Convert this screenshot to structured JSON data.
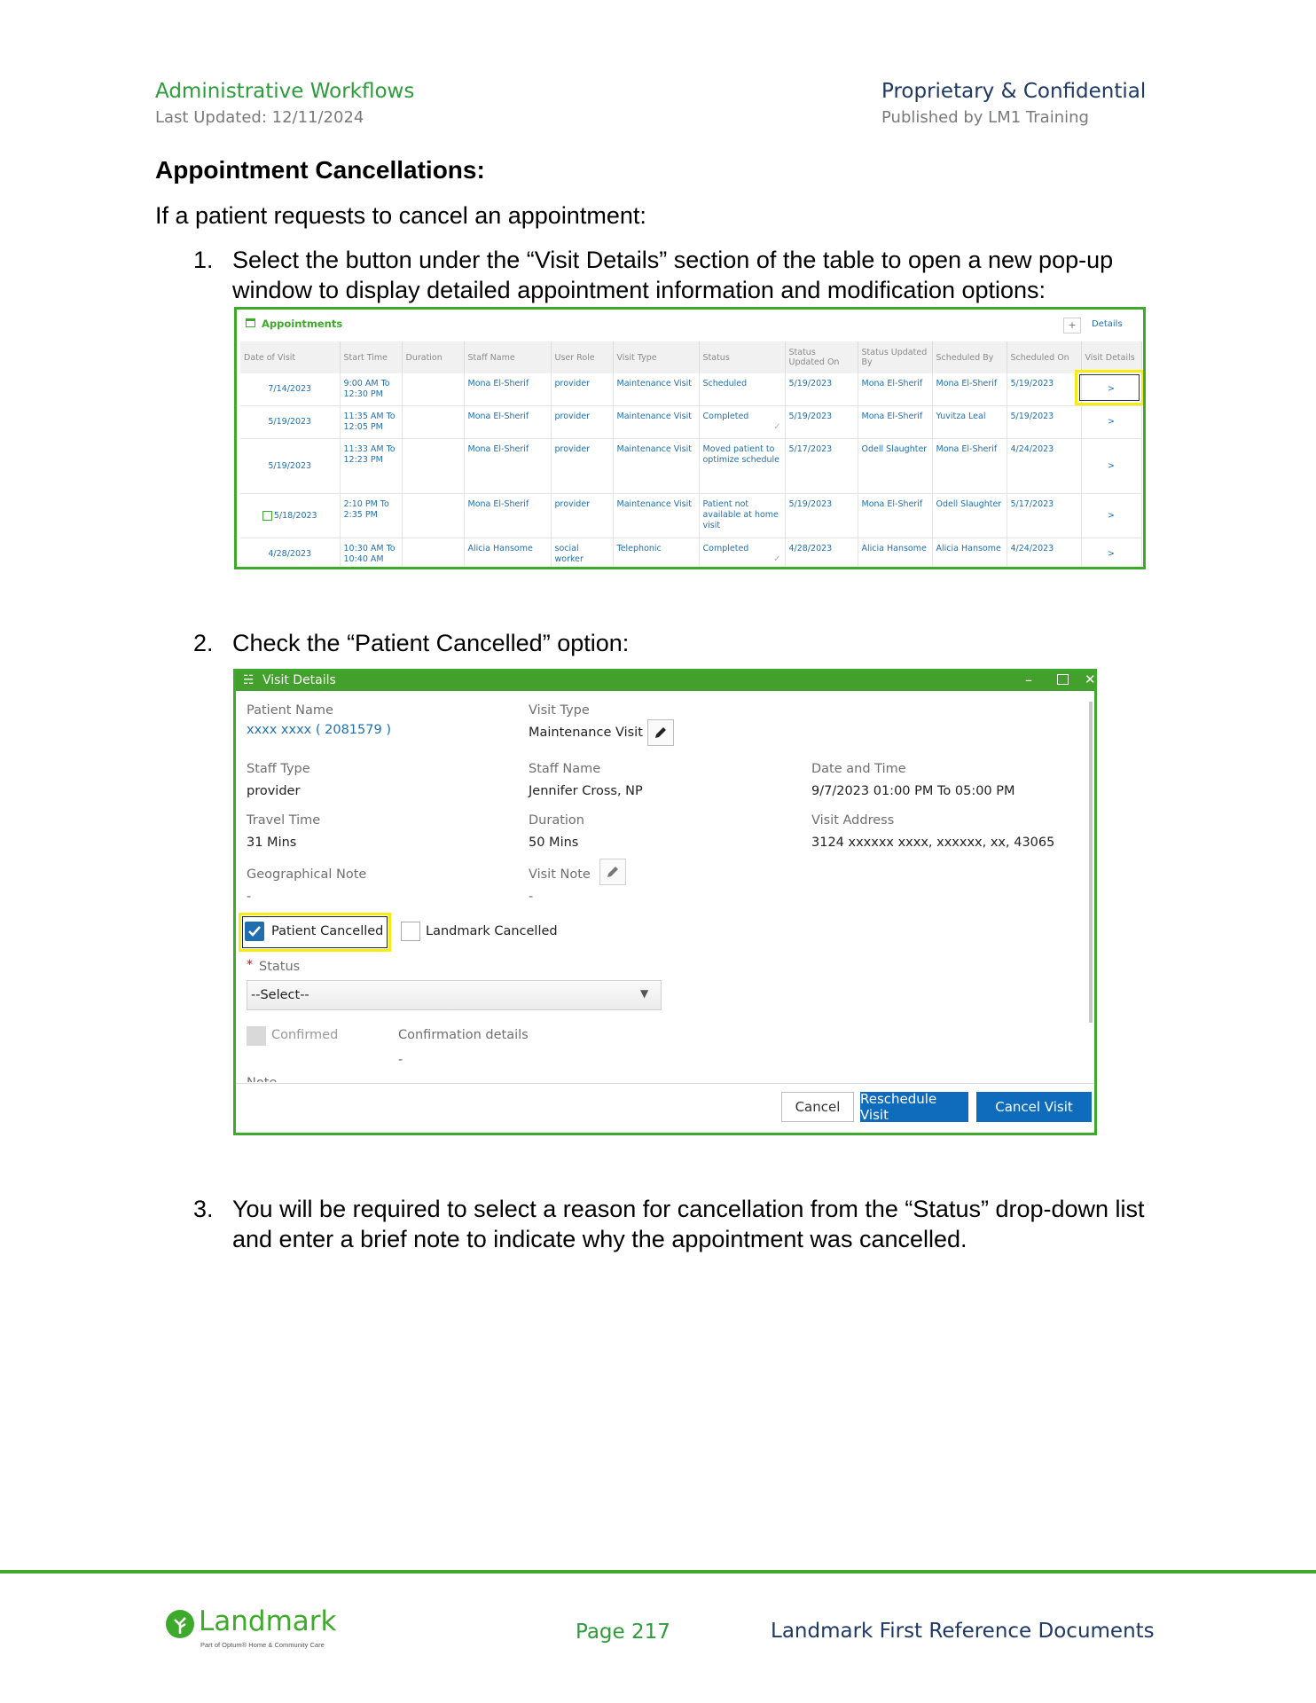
{
  "header": {
    "left_title": "Administrative Workflows",
    "left_sub": "Last Updated: 12/11/2024",
    "right_title": "Proprietary & Confidential",
    "right_sub": "Published by LM1 Training"
  },
  "section_title": "Appointment Cancellations:",
  "intro": "If a patient requests to cancel an appointment:",
  "steps": [
    {
      "num": "1.",
      "text": "Select the button under the “Visit Details” section of the table to open a new pop-up window to display detailed appointment information and modification options:"
    },
    {
      "num": "2.",
      "text": "Check the “Patient Cancelled” option:"
    },
    {
      "num": "3.",
      "text": "You will be required to select a reason for cancellation from the “Status” drop-down list and enter a brief note to indicate why the appointment was cancelled."
    }
  ],
  "appointments": {
    "title": "Appointments",
    "add_label": "+",
    "details_label": "Details",
    "columns": [
      "Date of Visit",
      "Start Time",
      "Duration",
      "Staff Name",
      "User Role",
      "Visit Type",
      "Status",
      "Status Updated On",
      "Status Updated By",
      "Scheduled By",
      "Scheduled On",
      "Visit Details"
    ],
    "rows": [
      {
        "date": "7/14/2023",
        "start": "9:00 AM To 12:30 PM",
        "duration": "",
        "staff": "Mona El-Sherif",
        "role": "provider",
        "visit_type": "Maintenance Visit",
        "status": "Scheduled",
        "checked": false,
        "updated_on": "5/19/2023",
        "updated_by": "Mona El-Sherif",
        "scheduled_by": "Mona El-Sherif",
        "scheduled_on": "5/19/2023",
        "details": ">",
        "calendar_icon": false
      },
      {
        "date": "5/19/2023",
        "start": "11:35 AM To 12:05 PM",
        "duration": "",
        "staff": "Mona El-Sherif",
        "role": "provider",
        "visit_type": "Maintenance Visit",
        "status": "Completed",
        "checked": true,
        "updated_on": "5/19/2023",
        "updated_by": "Mona El-Sherif",
        "scheduled_by": "Yuvitza Leal",
        "scheduled_on": "5/19/2023",
        "details": ">",
        "calendar_icon": false
      },
      {
        "date": "5/19/2023",
        "start": "11:33 AM To 12:23 PM",
        "duration": "",
        "staff": "Mona El-Sherif",
        "role": "provider",
        "visit_type": "Maintenance Visit",
        "status": "Moved patient to optimize schedule",
        "checked": false,
        "updated_on": "5/17/2023",
        "updated_by": "Odell Slaughter",
        "scheduled_by": "Mona El-Sherif",
        "scheduled_on": "4/24/2023",
        "details": ">",
        "calendar_icon": false
      },
      {
        "date": "5/18/2023",
        "start": "2:10 PM To 2:35 PM",
        "duration": "",
        "staff": "Mona El-Sherif",
        "role": "provider",
        "visit_type": "Maintenance Visit",
        "status": "Patient not available at home visit",
        "checked": false,
        "updated_on": "5/19/2023",
        "updated_by": "Mona El-Sherif",
        "scheduled_by": "Odell Slaughter",
        "scheduled_on": "5/17/2023",
        "details": ">",
        "calendar_icon": true
      },
      {
        "date": "4/28/2023",
        "start": "10:30 AM To 10:40 AM",
        "duration": "",
        "staff": "Alicia Hansome",
        "role": "social worker",
        "visit_type": "Telephonic",
        "status": "Completed",
        "checked": true,
        "updated_on": "4/28/2023",
        "updated_by": "Alicia Hansome",
        "scheduled_by": "Alicia Hansome",
        "scheduled_on": "4/24/2023",
        "details": ">",
        "calendar_icon": false
      }
    ]
  },
  "visit_details": {
    "title": "Visit Details",
    "patient_name_label": "Patient Name",
    "patient_name": "xxxx xxxx ( 2081579 )",
    "visit_type_label": "Visit Type",
    "visit_type": "Maintenance Visit",
    "staff_type_label": "Staff Type",
    "staff_type": "provider",
    "staff_name_label": "Staff Name",
    "staff_name": "Jennifer Cross, NP",
    "date_time_label": "Date and Time",
    "date_time": "9/7/2023 01:00 PM To 05:00 PM",
    "travel_time_label": "Travel Time",
    "travel_time": "31 Mins",
    "duration_label": "Duration",
    "duration": "50 Mins",
    "visit_address_label": "Visit Address",
    "visit_address": "3124 xxxxxx xxxx, xxxxxx, xx, 43065",
    "geo_note_label": "Geographical Note",
    "geo_note": "-",
    "visit_note_label": "Visit Note",
    "visit_note": "-",
    "patient_cancelled_label": "Patient Cancelled",
    "landmark_cancelled_label": "Landmark Cancelled",
    "status_label": "Status",
    "status_required": "*",
    "status_select": "--Select--",
    "confirmed_label": "Confirmed",
    "confirmation_details_label": "Confirmation details",
    "confirmation_details": "-",
    "note_label": "Note",
    "cancel_btn": "Cancel",
    "reschedule_btn": "Reschedule Visit",
    "cancel_visit_btn": "Cancel Visit"
  },
  "footer": {
    "logo_text": "Landmark",
    "logo_sub": "Part of Optum® Home & Community Care",
    "page": "Page 217",
    "doc_name": "Landmark First Reference Documents"
  },
  "colors": {
    "green": "#3eaa2b",
    "header_green": "#2e9c3b",
    "navy": "#1f3864",
    "link_blue": "#1f6fb0",
    "button_blue": "#0f6cbd",
    "highlight_yellow": "#f6ec12"
  }
}
